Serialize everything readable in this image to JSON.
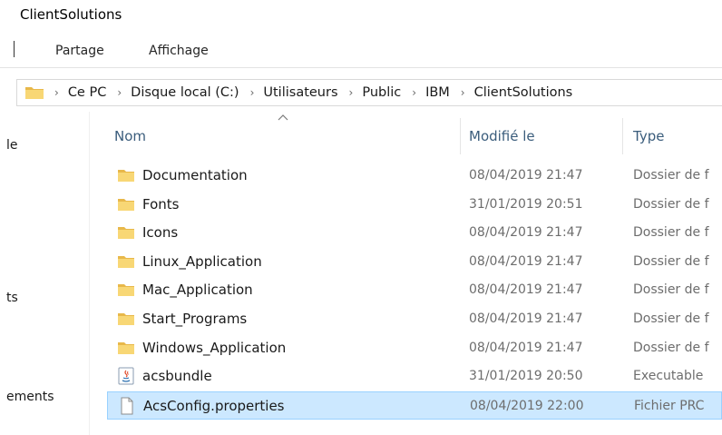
{
  "window": {
    "title": "ClientSolutions"
  },
  "ribbon": {
    "tabs": [
      "Partage",
      "Affichage"
    ]
  },
  "address": {
    "crumbs": [
      "Ce PC",
      "Disque local (C:)",
      "Utilisateurs",
      "Public",
      "IBM",
      "ClientSolutions"
    ]
  },
  "nav": {
    "items": [
      "le",
      "ts",
      "ements"
    ]
  },
  "columns": {
    "name": "Nom",
    "modified": "Modifié le",
    "type": "Type"
  },
  "sort": {
    "column": "name",
    "direction": "ascending"
  },
  "files": [
    {
      "name": "Documentation",
      "modified": "08/04/2019 21:47",
      "type": "Dossier de f",
      "icon": "folder-icon"
    },
    {
      "name": "Fonts",
      "modified": "31/01/2019 20:51",
      "type": "Dossier de f",
      "icon": "folder-icon"
    },
    {
      "name": "Icons",
      "modified": "08/04/2019 21:47",
      "type": "Dossier de f",
      "icon": "folder-icon"
    },
    {
      "name": "Linux_Application",
      "modified": "08/04/2019 21:47",
      "type": "Dossier de f",
      "icon": "folder-icon"
    },
    {
      "name": "Mac_Application",
      "modified": "08/04/2019 21:47",
      "type": "Dossier de f",
      "icon": "folder-icon"
    },
    {
      "name": "Start_Programs",
      "modified": "08/04/2019 21:47",
      "type": "Dossier de f",
      "icon": "folder-icon"
    },
    {
      "name": "Windows_Application",
      "modified": "08/04/2019 21:47",
      "type": "Dossier de f",
      "icon": "folder-icon"
    },
    {
      "name": "acsbundle",
      "modified": "31/01/2019 20:50",
      "type": "Executable",
      "icon": "java-jar-icon"
    },
    {
      "name": "AcsConfig.properties",
      "modified": "08/04/2019 22:00",
      "type": "Fichier PRC",
      "icon": "document-icon",
      "selected": true
    }
  ],
  "colors": {
    "folder": "#f8d775",
    "selection": "#cce8ff",
    "header_text": "#3b5d7c"
  }
}
